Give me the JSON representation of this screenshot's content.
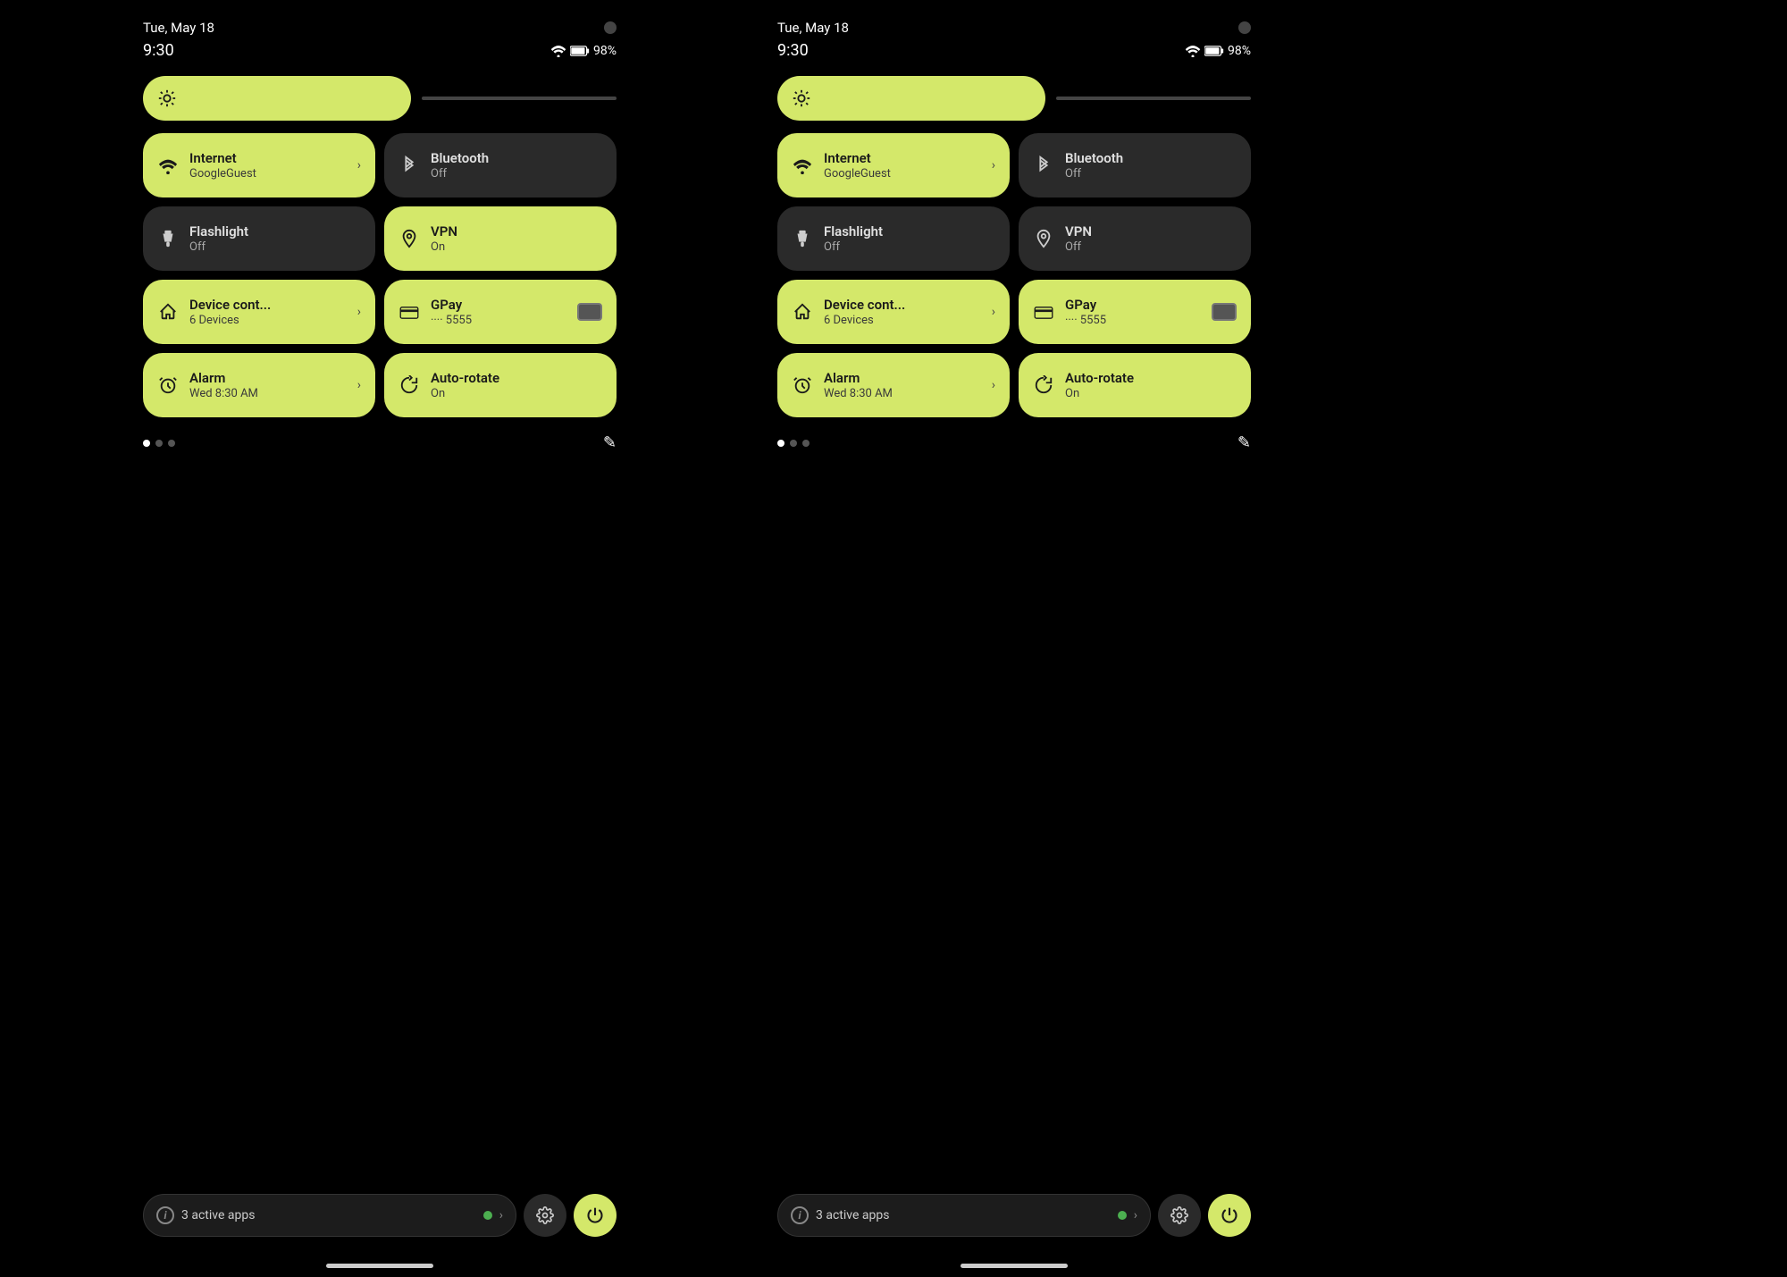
{
  "panels": [
    {
      "id": "panel-left",
      "statusDate": "Tue, May 18",
      "statusTime": "9:30",
      "battery": "98%",
      "brightnessLabel": "brightness",
      "tiles": [
        {
          "id": "internet",
          "active": true,
          "icon": "wifi",
          "title": "Internet",
          "subtitle": "GoogleGuest",
          "hasChevron": true,
          "hasCard": false
        },
        {
          "id": "bluetooth",
          "active": false,
          "icon": "bluetooth",
          "title": "Bluetooth",
          "subtitle": "Off",
          "hasChevron": false,
          "hasCard": false
        },
        {
          "id": "flashlight",
          "active": false,
          "icon": "flashlight",
          "title": "Flashlight",
          "subtitle": "Off",
          "hasChevron": false,
          "hasCard": false
        },
        {
          "id": "vpn",
          "active": true,
          "icon": "vpn",
          "title": "VPN",
          "subtitle": "On",
          "hasChevron": false,
          "hasCard": false
        },
        {
          "id": "device-control",
          "active": true,
          "icon": "home",
          "title": "Device cont...",
          "subtitle": "6 Devices",
          "hasChevron": true,
          "hasCard": false
        },
        {
          "id": "gpay",
          "active": true,
          "icon": "gpay",
          "title": "GPay",
          "subtitle": "···· 5555",
          "hasChevron": false,
          "hasCard": true
        },
        {
          "id": "alarm",
          "active": true,
          "icon": "alarm",
          "title": "Alarm",
          "subtitle": "Wed 8:30 AM",
          "hasChevron": true,
          "hasCard": false
        },
        {
          "id": "autorotate",
          "active": true,
          "icon": "autorotate",
          "title": "Auto-rotate",
          "subtitle": "On",
          "hasChevron": false,
          "hasCard": false
        }
      ],
      "activeApps": "3 active apps"
    },
    {
      "id": "panel-right",
      "statusDate": "Tue, May 18",
      "statusTime": "9:30",
      "battery": "98%",
      "brightnessLabel": "brightness",
      "tiles": [
        {
          "id": "internet",
          "active": true,
          "icon": "wifi",
          "title": "Internet",
          "subtitle": "GoogleGuest",
          "hasChevron": true,
          "hasCard": false
        },
        {
          "id": "bluetooth",
          "active": false,
          "icon": "bluetooth",
          "title": "Bluetooth",
          "subtitle": "Off",
          "hasChevron": false,
          "hasCard": false
        },
        {
          "id": "flashlight",
          "active": false,
          "icon": "flashlight",
          "title": "Flashlight",
          "subtitle": "Off",
          "hasChevron": false,
          "hasCard": false
        },
        {
          "id": "vpn",
          "active": false,
          "icon": "vpn",
          "title": "VPN",
          "subtitle": "Off",
          "hasChevron": false,
          "hasCard": false
        },
        {
          "id": "device-control",
          "active": true,
          "icon": "home",
          "title": "Device cont...",
          "subtitle": "6 Devices",
          "hasChevron": true,
          "hasCard": false
        },
        {
          "id": "gpay",
          "active": true,
          "icon": "gpay",
          "title": "GPay",
          "subtitle": "···· 5555",
          "hasChevron": false,
          "hasCard": true
        },
        {
          "id": "alarm",
          "active": true,
          "icon": "alarm",
          "title": "Alarm",
          "subtitle": "Wed 8:30 AM",
          "hasChevron": true,
          "hasCard": false
        },
        {
          "id": "autorotate",
          "active": true,
          "icon": "autorotate",
          "title": "Auto-rotate",
          "subtitle": "On",
          "hasChevron": false,
          "hasCard": false
        }
      ],
      "activeApps": "3 active apps"
    }
  ],
  "colors": {
    "active": "#d4e86a",
    "inactive": "#2a2a2a",
    "background": "#000000"
  }
}
